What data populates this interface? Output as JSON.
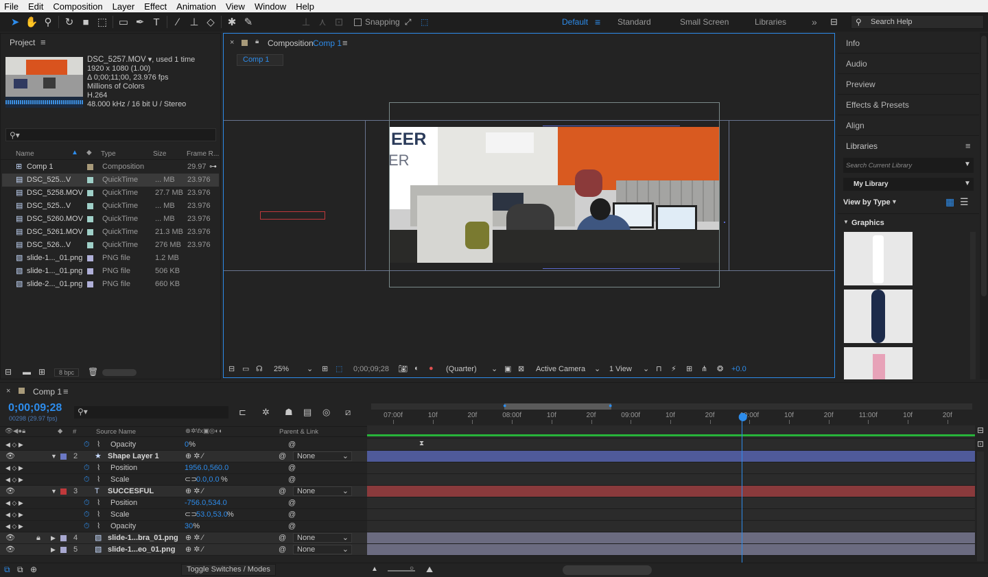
{
  "menu": [
    "File",
    "Edit",
    "Composition",
    "Layer",
    "Effect",
    "Animation",
    "View",
    "Window",
    "Help"
  ],
  "toolbar": {
    "snapping_label": "Snapping",
    "workspaces": {
      "active": "Default",
      "standard": "Standard",
      "small_screen": "Small Screen",
      "libraries": "Libraries"
    },
    "search_placeholder": "Search Help"
  },
  "project": {
    "title": "Project",
    "item_name": "DSC_5257.MOV",
    "item_used": ", used 1 time",
    "item_dims": "1920 x 1080 (1.00)",
    "item_duration": "Δ 0;00;11;00, 23.976 fps",
    "item_colors": "Millions of Colors",
    "item_codec": "H.264",
    "item_audio": "48.000 kHz / 16 bit U / Stereo",
    "columns": {
      "name": "Name",
      "type": "Type",
      "size": "Size",
      "frame_rate": "Frame R..."
    },
    "items": [
      {
        "name": "Comp 1",
        "type": "Composition",
        "size": "",
        "fps": "29.97",
        "swatch": "#a89a7a",
        "icon": "comp-icon"
      },
      {
        "name": "DSC_525...V",
        "type": "QuickTime",
        "size": "... MB",
        "fps": "23.976",
        "swatch": "#9fd0c8",
        "icon": "movie-file-icon"
      },
      {
        "name": "DSC_5258.MOV",
        "type": "QuickTime",
        "size": "27.7 MB",
        "fps": "23.976",
        "swatch": "#9fd0c8",
        "icon": "movie-file-icon"
      },
      {
        "name": "DSC_525...V",
        "type": "QuickTime",
        "size": "... MB",
        "fps": "23.976",
        "swatch": "#9fd0c8",
        "icon": "movie-file-icon"
      },
      {
        "name": "DSC_5260.MOV",
        "type": "QuickTime",
        "size": "... MB",
        "fps": "23.976",
        "swatch": "#9fd0c8",
        "icon": "movie-file-icon"
      },
      {
        "name": "DSC_5261.MOV",
        "type": "QuickTime",
        "size": "21.3 MB",
        "fps": "23.976",
        "swatch": "#9fd0c8",
        "icon": "movie-file-icon"
      },
      {
        "name": "DSC_526...V",
        "type": "QuickTime",
        "size": "276 MB",
        "fps": "23.976",
        "swatch": "#9fd0c8",
        "icon": "movie-file-icon"
      },
      {
        "name": "slide-1..._01.png",
        "type": "PNG file",
        "size": "1.2 MB",
        "fps": "",
        "swatch": "#b0b0d8",
        "icon": "image-file-icon"
      },
      {
        "name": "slide-1..._01.png",
        "type": "PNG file",
        "size": "506 KB",
        "fps": "",
        "swatch": "#b0b0d8",
        "icon": "image-file-icon"
      },
      {
        "name": "slide-2..._01.png",
        "type": "PNG file",
        "size": "660 KB",
        "fps": "",
        "swatch": "#b0b0d8",
        "icon": "image-file-icon"
      }
    ],
    "bpc": "8 bpc"
  },
  "composition": {
    "tab_title": "Composition",
    "tab_comp": "Comp 1",
    "sub_tab": "Comp 1",
    "zoom": "25%",
    "timecode": "0;00;09;28",
    "resolution": "(Quarter)",
    "camera": "Active Camera",
    "views": "1 View",
    "exposure": "+0.0",
    "sign_text": "EER",
    "sign_sub": "ER"
  },
  "right_panels": [
    "Info",
    "Audio",
    "Preview",
    "Effects & Presets",
    "Align"
  ],
  "libraries": {
    "title": "Libraries",
    "search_placeholder": "Search Current Library",
    "library": "My Library",
    "view_by": "View by Type",
    "section": "Graphics"
  },
  "timeline": {
    "comp_tab": "Comp 1",
    "timecode": "0;00;09;28",
    "frame_info": "00298 (29.97 fps)",
    "col_source": "Source Name",
    "col_parent": "Parent & Link",
    "ruler": [
      "07:00f",
      "10f",
      "20f",
      "08:00f",
      "10f",
      "20f",
      "09:00f",
      "10f",
      "20f",
      "10:00f",
      "10f",
      "20f",
      "11:00f",
      "10f",
      "20f"
    ],
    "rows": [
      {
        "kind": "prop",
        "name": "Opacity",
        "value": "0",
        "unit": "%"
      },
      {
        "kind": "layer",
        "num": "2",
        "name": "Shape Layer 1",
        "parent": "None",
        "color": "#6b78c4",
        "bar": "#4f5a9a",
        "icon": "star-icon"
      },
      {
        "kind": "prop",
        "name": "Position",
        "value": "1956.0,560.0",
        "unit": ""
      },
      {
        "kind": "prop",
        "name": "Scale",
        "value": "0.0,0.0",
        "unit": "%"
      },
      {
        "kind": "layer",
        "num": "3",
        "name": "SUCCESFUL",
        "parent": "None",
        "color": "#c0393b",
        "bar": "#8a3a3c",
        "icon": "text-icon"
      },
      {
        "kind": "prop",
        "name": "Position",
        "value": "-756.0,534.0",
        "unit": ""
      },
      {
        "kind": "prop",
        "name": "Scale",
        "value": "53.0,53.0",
        "unit": "%"
      },
      {
        "kind": "prop",
        "name": "Opacity",
        "value": "30",
        "unit": "%"
      },
      {
        "kind": "layer",
        "num": "4",
        "name": "slide-1...bra_01.png",
        "parent": "None",
        "color": "#a8a8d0",
        "bar": "#6b6b80",
        "icon": "image-file-icon"
      },
      {
        "kind": "layer",
        "num": "5",
        "name": "slide-1...eo_01.png",
        "parent": "None",
        "color": "#a8a8d0",
        "bar": "#6b6b80",
        "icon": "image-file-icon"
      }
    ],
    "toggle_label": "Toggle Switches / Modes"
  }
}
